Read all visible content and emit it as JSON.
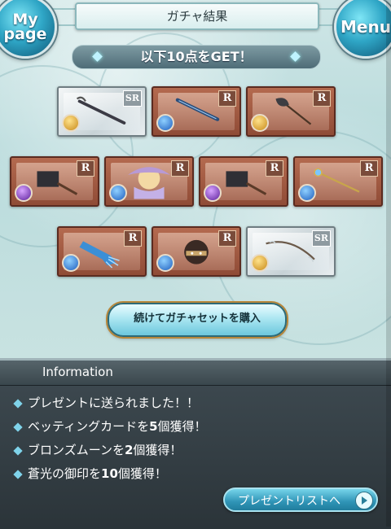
{
  "header": {
    "title": "ガチャ結果",
    "mypage_label": "My page",
    "menu_label": "Menu"
  },
  "banner": {
    "text": "以下10点をGET！"
  },
  "cards": [
    {
      "rarity": "SR",
      "element": "light",
      "item": "staff"
    },
    {
      "rarity": "R",
      "element": "water",
      "item": "katana"
    },
    {
      "rarity": "R",
      "element": "light",
      "item": "axe"
    },
    {
      "rarity": "R",
      "element": "dark",
      "item": "cleaver"
    },
    {
      "rarity": "R",
      "element": "water",
      "item": "summon-character"
    },
    {
      "rarity": "R",
      "element": "dark",
      "item": "cleaver"
    },
    {
      "rarity": "R",
      "element": "water",
      "item": "wand"
    },
    {
      "rarity": "R",
      "element": "water",
      "item": "gauntlet"
    },
    {
      "rarity": "R",
      "element": "water",
      "item": "mask-creature"
    },
    {
      "rarity": "SR",
      "element": "light",
      "item": "bow-staff"
    }
  ],
  "buy_button": {
    "label": "続けてガチャセットを購入"
  },
  "info": {
    "title": "Information",
    "rows": [
      {
        "pre": "プレゼントに送られました！！",
        "num": "",
        "post": ""
      },
      {
        "pre": "ベッティングカードを",
        "num": "5",
        "post": "個獲得！"
      },
      {
        "pre": "ブロンズムーンを",
        "num": "2",
        "post": "個獲得！"
      },
      {
        "pre": "蒼光の御印を",
        "num": "10",
        "post": "個獲得！"
      }
    ],
    "present_button": "プレゼントリストへ"
  },
  "colors": {
    "accent": "#2f94b6",
    "info_bg": "#2b3439",
    "card_r": "#8f4b36"
  }
}
